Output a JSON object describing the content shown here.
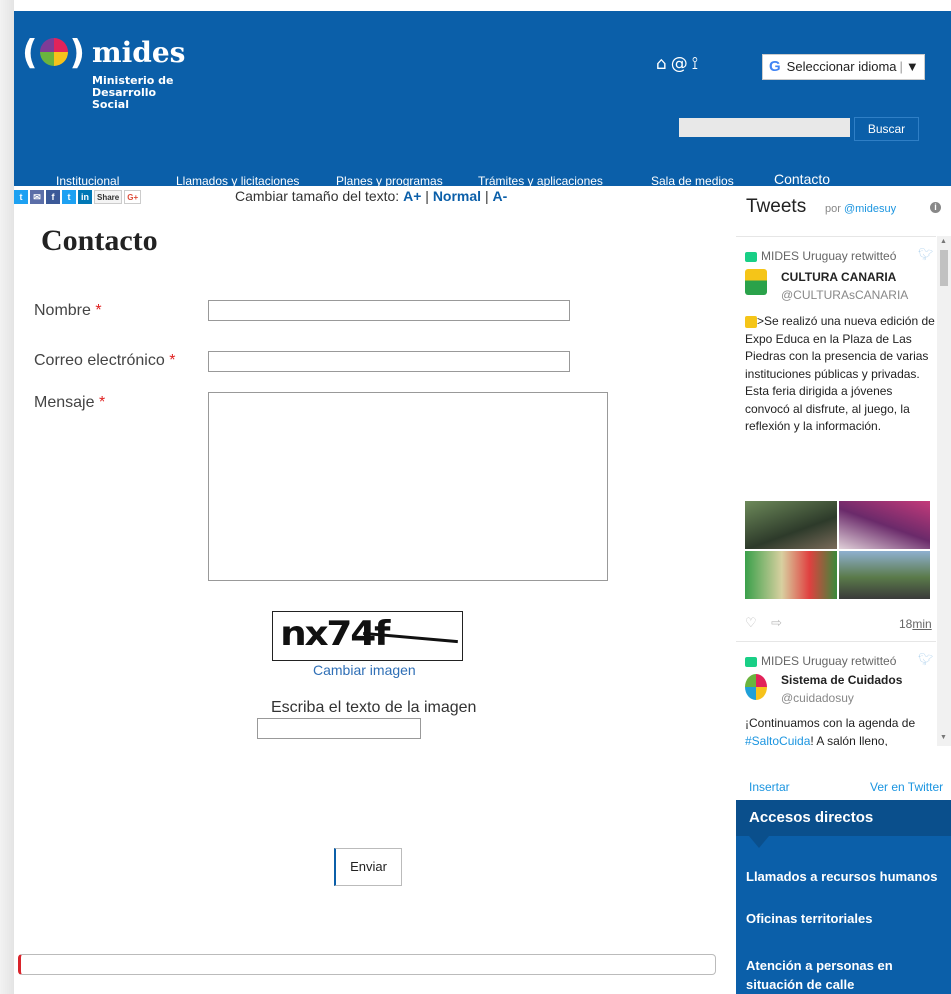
{
  "header": {
    "logo_text": "mides",
    "logo_sub_line1": "Ministerio de",
    "logo_sub_line2": "Desarrollo Social",
    "icons": [
      "home-icon",
      "at-icon",
      "sitemap-icon"
    ],
    "translate_g": "G",
    "translate_label": "Seleccionar idioma",
    "translate_arrow": "▼",
    "search_button": "Buscar"
  },
  "nav": {
    "items": [
      "Institucional",
      "Llamados y licitaciones",
      "Planes y programas",
      "Trámites y aplicaciones",
      "Sala de medios",
      "Contacto"
    ]
  },
  "share": {
    "share_label": "Share",
    "gplus_label": "G+",
    "icons": [
      "twitter-icon",
      "email-icon",
      "facebook-icon",
      "twitter-icon",
      "linkedin-icon"
    ]
  },
  "text_size": {
    "prefix": "Cambiar tamaño del texto:",
    "larger": "A+",
    "normal": "Normal",
    "smaller": "A-",
    "sep": "|"
  },
  "form": {
    "title": "Contacto",
    "name_label": "Nombre",
    "email_label": "Correo electrónico",
    "message_label": "Mensaje",
    "required_mark": "*",
    "captcha_text": "nx74f",
    "change_image": "Cambiar imagen",
    "captcha_label": "Escriba el texto de la imagen",
    "submit": "Enviar"
  },
  "twitter": {
    "title": "Tweets",
    "by_prefix": "por",
    "by_handle": "@midesuy",
    "info": "i",
    "tweets": [
      {
        "retweet_label": "MIDES Uruguay retwitteó",
        "name": "CULTURA CANARIA",
        "handle": "@CULTURAsCANARIA",
        "text": ">Se realizó una nueva edición de Expo Educa en la Plaza de Las Piedras con la presencia de varias instituciones públicas y privadas. Esta feria dirigida a jóvenes convocó al disfrute, al juego, la reflexión y la información.",
        "time_num": "18",
        "time_unit": "min"
      },
      {
        "retweet_label": "MIDES Uruguay retwitteó",
        "name": "Sistema de Cuidados",
        "handle": "@cuidadosuy",
        "text_before": "¡Continuamos con la agenda de ",
        "hashtag": "#SaltoCuida",
        "text_after": "! A salón lleno, trabajamos sobre responsabilidad compartida con educadoras y"
      }
    ],
    "insert": "Insertar",
    "view": "Ver en Twitter"
  },
  "direct_access": {
    "title": "Accesos directos",
    "items": [
      "Llamados a recursos humanos",
      "Oficinas territoriales",
      "Atención a personas en situación de calle"
    ]
  },
  "colors": {
    "brand_blue": "#0b5fa9",
    "required_red": "#e02020",
    "link_blue": "#2f6fb6",
    "twitter_blue": "#1b95e0"
  }
}
